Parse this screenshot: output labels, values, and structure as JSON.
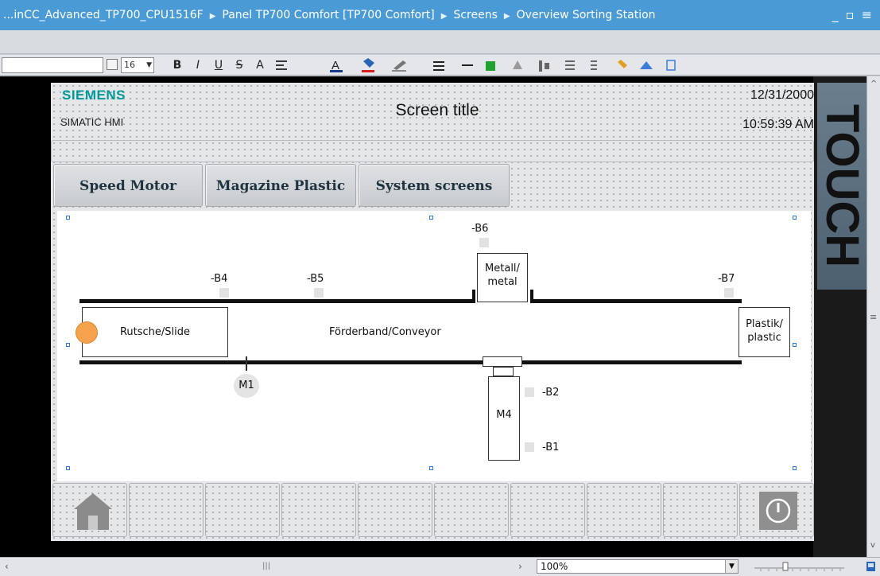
{
  "window": {
    "breadcrumb": [
      "...inCC_Advanced_TP700_CPU1516F",
      "Panel TP700 Comfort [TP700 Comfort]",
      "Screens",
      "Overview Sorting Station"
    ],
    "controls": "_ ▫ ≡ ✕"
  },
  "toolbar": {
    "font_size": "16",
    "buttons": [
      "B",
      "I",
      "U",
      "S",
      "A"
    ]
  },
  "hmi": {
    "brand": "SIEMENS",
    "product": "SIMATIC HMI",
    "screen_title": "Screen title",
    "date": "12/31/2000",
    "time": "10:59:39 AM",
    "bezel_text": "TOUCH",
    "nav_buttons": [
      "Speed Motor",
      "Magazine Plastic",
      "System screens"
    ]
  },
  "diagram": {
    "b6": "-B6",
    "metal_box": [
      "Metall/",
      "metal"
    ],
    "b4": "-B4",
    "b5": "-B5",
    "b7": "-B7",
    "slide_box": "Rutsche/Slide",
    "conveyor": "Förderband/Conveyor",
    "plastic_box": [
      "Plastik/",
      "plastic"
    ],
    "m1": "M1",
    "m4": "M4",
    "b2": "-B2",
    "b1": "-B1"
  },
  "statusbar": {
    "zoom": "100%"
  },
  "colors": {
    "brand": "#009999",
    "titlebar": "#4a9bd5",
    "indicator": "#f6a24d"
  }
}
